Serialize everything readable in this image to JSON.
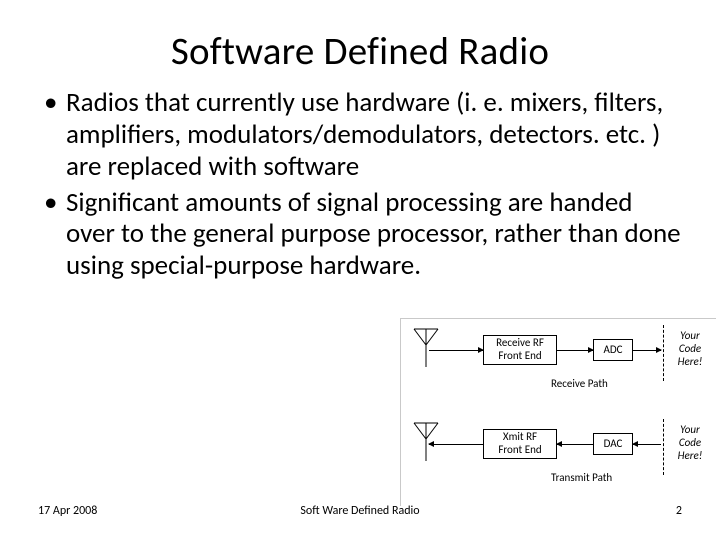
{
  "title": "Software Defined Radio",
  "bullets": [
    "Radios that currently use hardware (i. e. mixers, filters, amplifiers, modulators/demodulators, detectors. etc. ) are replaced with software",
    "Significant amounts of signal processing are handed over to the general purpose processor, rather than done using special-purpose hardware."
  ],
  "diagram": {
    "receive": {
      "fe": "Receive RF\nFront End",
      "conv": "ADC",
      "code": "Your\nCode\nHere!",
      "label": "Receive Path"
    },
    "transmit": {
      "fe": "Xmit RF\nFront End",
      "conv": "DAC",
      "code": "Your\nCode\nHere!",
      "label": "Transmit Path"
    }
  },
  "footer": {
    "date": "17 Apr 2008",
    "center": "Soft Ware Defined Radio",
    "page": "2"
  }
}
